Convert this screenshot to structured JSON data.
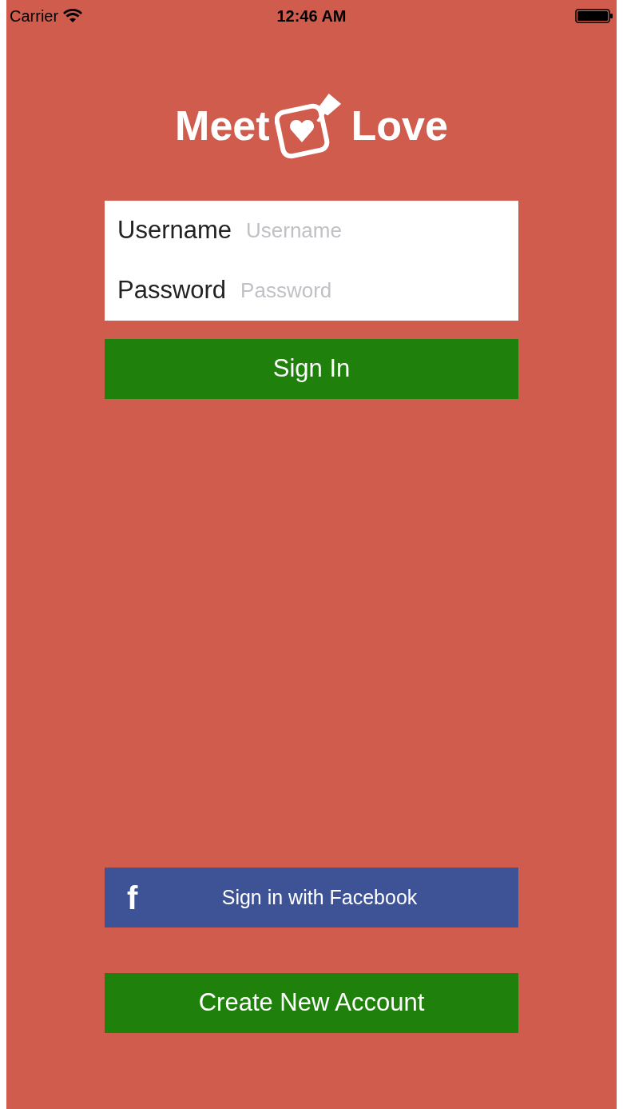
{
  "status_bar": {
    "carrier": "Carrier",
    "time": "12:46 AM"
  },
  "logo": {
    "left": "Meet",
    "right": "Love"
  },
  "form": {
    "fields": [
      {
        "label": "Username",
        "placeholder": "Username"
      },
      {
        "label": "Password",
        "placeholder": "Password"
      }
    ]
  },
  "sign_in_button": "Sign In",
  "facebook_button": {
    "icon": "f",
    "label": "Sign in with Facebook"
  },
  "create_account_button": "Create New Account"
}
